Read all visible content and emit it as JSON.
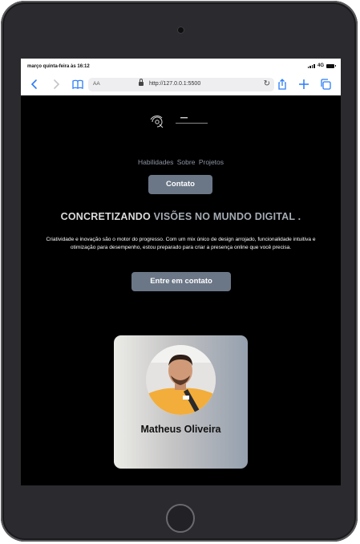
{
  "status_bar": {
    "time": "março quinta-feira às 16:12",
    "network": "4G"
  },
  "browser": {
    "text_size_label": "AA",
    "url": "http://127.0.0.1:5500"
  },
  "nav": {
    "items": [
      "Habilidades",
      "Sobre",
      "Projetos"
    ],
    "contact_button": "Contato"
  },
  "hero": {
    "headline_part1": "CONCRETIZANDO",
    "headline_part2": "VISÕES NO MUNDO DIGITAL .",
    "description": "Criatividade e inovação são o motor do progresso. Com um mix único de design arrojado, funcionalidade intuitiva e otimização para desempenho, estou preparado para criar a presença online que você precisa.",
    "cta_button": "Entre em contato"
  },
  "profile": {
    "name": "Matheus Oliveira"
  },
  "colors": {
    "button_bg": "#6b7787",
    "nav_text": "#8d95a3",
    "accent_blue": "#2a7cf7",
    "page_bg": "#000000"
  }
}
